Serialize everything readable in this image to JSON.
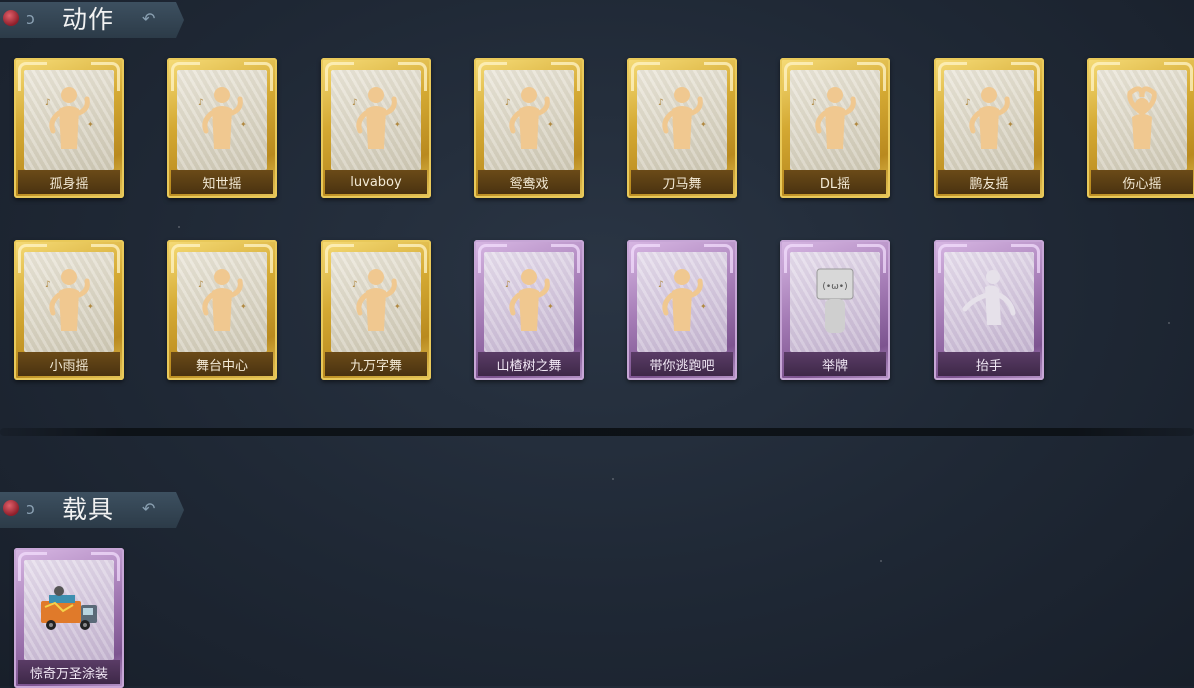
{
  "sections": [
    {
      "title": "动作",
      "items": [
        {
          "label": "孤身摇",
          "rarity": "gold",
          "icon": "dance-pose-icon"
        },
        {
          "label": "知世摇",
          "rarity": "gold",
          "icon": "dance-pose-icon"
        },
        {
          "label": "luvaboy",
          "rarity": "gold",
          "icon": "dance-pose-icon"
        },
        {
          "label": "鸳鸯戏",
          "rarity": "gold",
          "icon": "dance-pose-icon"
        },
        {
          "label": "刀马舞",
          "rarity": "gold",
          "icon": "dance-pose-icon"
        },
        {
          "label": "DL摇",
          "rarity": "gold",
          "icon": "dance-pose-icon"
        },
        {
          "label": "鹏友摇",
          "rarity": "gold",
          "icon": "dance-pose-icon"
        },
        {
          "label": "伤心摇",
          "rarity": "gold",
          "icon": "heart-hands-pose-icon"
        },
        {
          "label": "小雨摇",
          "rarity": "gold",
          "icon": "dance-pose-icon"
        },
        {
          "label": "舞台中心",
          "rarity": "gold",
          "icon": "dance-pose-icon"
        },
        {
          "label": "九万字舞",
          "rarity": "gold",
          "icon": "dance-pose-icon"
        },
        {
          "label": "山楂树之舞",
          "rarity": "purple",
          "icon": "dance-pose-icon"
        },
        {
          "label": "带你逃跑吧",
          "rarity": "purple",
          "icon": "dance-pose-icon"
        },
        {
          "label": "举牌",
          "rarity": "purple",
          "icon": "holding-sign-icon"
        },
        {
          "label": "抬手",
          "rarity": "purple",
          "icon": "raise-hand-icon"
        }
      ]
    },
    {
      "title": "载具",
      "items": [
        {
          "label": "惊奇万圣涂装",
          "rarity": "purple",
          "icon": "truck-icon"
        }
      ]
    }
  ],
  "colors": {
    "background": "#1f2835",
    "gold_frame": "#d4a933",
    "purple_frame": "#a57cb6",
    "pose_figure": "#f0c890",
    "header_banner": "#3d5060"
  }
}
